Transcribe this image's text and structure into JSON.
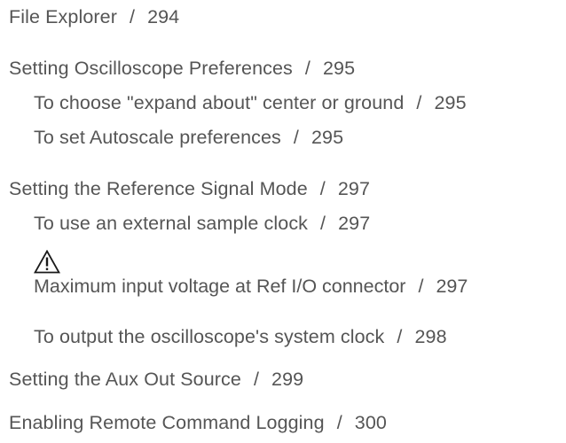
{
  "toc": {
    "entries": [
      {
        "title": "File Explorer",
        "page": "294"
      },
      {
        "title": "Setting Oscilloscope Preferences",
        "page": "295"
      },
      {
        "title": "To choose \"expand about\" center or ground",
        "page": "295"
      },
      {
        "title": "To set Autoscale preferences",
        "page": "295"
      },
      {
        "title": "Setting the Reference Signal Mode",
        "page": "297"
      },
      {
        "title": "To use an external sample clock",
        "page": "297"
      },
      {
        "title": "Maximum input voltage at Ref I/O connector",
        "page": "297",
        "icon": "warning-triangle-icon"
      },
      {
        "title": "To output the oscilloscope's system clock",
        "page": "298"
      },
      {
        "title": "Setting the Aux Out Source",
        "page": "299"
      },
      {
        "title": "Enabling Remote Command Logging",
        "page": "300"
      }
    ],
    "separator": "/"
  }
}
